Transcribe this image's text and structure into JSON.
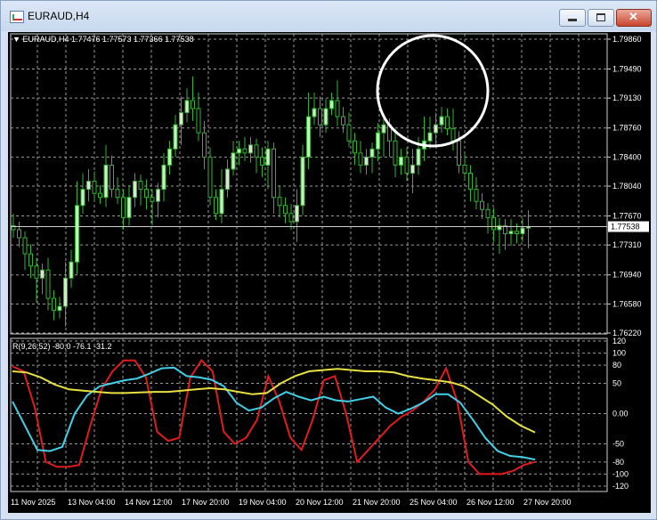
{
  "window": {
    "title": "EURAUD,H4",
    "minimize_icon": "minimize-icon",
    "maximize_icon": "maximize-icon",
    "close_icon": "close-icon",
    "close_glyph": "✕"
  },
  "header": {
    "symbol": "EURAUD,H4",
    "ohlc": "1.77476 1.77573 1.77366 1.77538",
    "menu_icon": "triangle-down-icon"
  },
  "price_axis": {
    "ticks": [
      "1.79860",
      "1.79490",
      "1.79130",
      "1.78760",
      "1.78400",
      "1.78040",
      "1.77670",
      "1.77310",
      "1.76940",
      "1.76580",
      "1.76220"
    ],
    "current_price": "1.77538"
  },
  "indicator": {
    "label": "R(9,26,52) -80.0 -76.1 -31.2",
    "axis_ticks": [
      "120",
      "100",
      "80",
      "50",
      "0.00",
      "-50",
      "-80",
      "-100",
      "-120"
    ]
  },
  "time_axis": {
    "labels": [
      "11 Nov 2025",
      "13 Nov 04:00",
      "14 Nov 12:00",
      "17 Nov 20:00",
      "19 Nov 04:00",
      "20 Nov 12:00",
      "21 Nov 20:00",
      "25 Nov 04:00",
      "26 Nov 12:00",
      "27 Nov 20:00"
    ]
  },
  "colors": {
    "background": "#000000",
    "grid": "#9a9a9a",
    "candle_bull": "#c8f0c0",
    "candle_bear": "#000000",
    "wick": "#32b432",
    "line_red": "#e01c1c",
    "line_cyan": "#40d0e8",
    "line_yellow": "#e8e040",
    "highlight_circle": "#ffffff"
  },
  "chart_data": [
    {
      "type": "candlestick",
      "title": "EURAUD,H4",
      "ylim": [
        1.7622,
        1.7986
      ],
      "x": [
        "11 Nov 2025",
        "13 Nov 04:00",
        "14 Nov 12:00",
        "17 Nov 20:00",
        "19 Nov 04:00",
        "20 Nov 12:00",
        "21 Nov 20:00",
        "25 Nov 04:00",
        "26 Nov 12:00",
        "27 Nov 20:00"
      ],
      "close_series": [
        1.775,
        1.774,
        1.772,
        1.7705,
        1.769,
        1.77,
        1.7665,
        1.765,
        1.7655,
        1.769,
        1.771,
        1.778,
        1.78,
        1.781,
        1.7795,
        1.779,
        1.783,
        1.78,
        1.779,
        1.7765,
        1.779,
        1.781,
        1.78,
        1.779,
        1.7785,
        1.78,
        1.783,
        1.785,
        1.788,
        1.7895,
        1.791,
        1.79,
        1.787,
        1.784,
        1.779,
        1.777,
        1.78,
        1.7825,
        1.7845,
        1.785,
        1.7845,
        1.7855,
        1.784,
        1.783,
        1.785,
        1.779,
        1.778,
        1.777,
        1.776,
        1.778,
        1.784,
        1.789,
        1.79,
        1.788,
        1.79,
        1.791,
        1.789,
        1.788,
        1.786,
        1.7845,
        1.783,
        1.784,
        1.785,
        1.787,
        1.788,
        1.786,
        1.783,
        1.784,
        1.782,
        1.783,
        1.785,
        1.786,
        1.787,
        1.788,
        1.789,
        1.7875,
        1.786,
        1.783,
        1.782,
        1.78,
        1.7785,
        1.7775,
        1.7765,
        1.775,
        1.7755,
        1.7745,
        1.7748,
        1.7745,
        1.7752,
        1.7754
      ],
      "current": 1.77538
    },
    {
      "type": "line",
      "title": "R(9,26,52)",
      "ylim": [
        -120,
        120
      ],
      "series": [
        {
          "name": "R(9)",
          "values": [
            78,
            70,
            10,
            -80,
            -88,
            -88,
            -85,
            -20,
            40,
            70,
            88,
            88,
            60,
            -30,
            -45,
            -40,
            60,
            88,
            70,
            -30,
            -50,
            -40,
            -10,
            62,
            20,
            -40,
            -60,
            -10,
            55,
            62,
            0,
            -80,
            -60,
            -40,
            -20,
            -5,
            5,
            20,
            40,
            75,
            20,
            -80,
            -100,
            -100,
            -100,
            -95,
            -85,
            -80
          ]
        },
        {
          "name": "R(26)",
          "values": [
            20,
            -20,
            -60,
            -62,
            -55,
            0,
            30,
            45,
            50,
            55,
            58,
            66,
            75,
            76,
            62,
            60,
            56,
            45,
            18,
            5,
            10,
            25,
            36,
            28,
            22,
            28,
            22,
            20,
            24,
            28,
            10,
            0,
            8,
            18,
            32,
            32,
            18,
            -10,
            -40,
            -62,
            -70,
            -72,
            -76
          ]
        },
        {
          "name": "R(52)",
          "values": [
            70,
            68,
            60,
            48,
            40,
            38,
            36,
            34,
            34,
            35,
            36,
            36,
            38,
            40,
            42,
            40,
            36,
            32,
            34,
            50,
            62,
            70,
            72,
            74,
            72,
            70,
            70,
            68,
            62,
            58,
            55,
            52,
            45,
            30,
            15,
            -5,
            -20,
            -31
          ]
        }
      ]
    }
  ]
}
